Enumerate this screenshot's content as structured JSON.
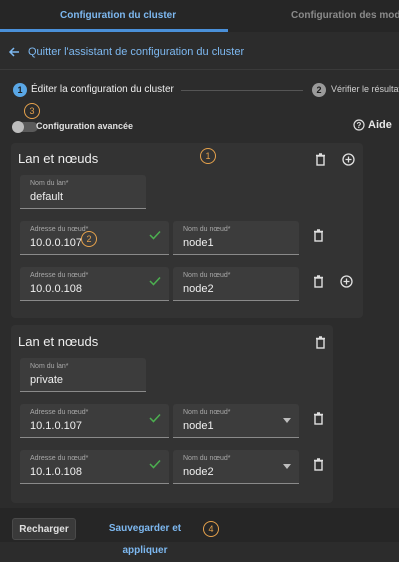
{
  "tabs": [
    "Configuration du cluster",
    "Configuration des modules"
  ],
  "back_label": "Quitter l'assistant de configuration du cluster",
  "steps": [
    {
      "number": "1",
      "label": "Éditer la configuration du cluster"
    },
    {
      "number": "2",
      "label": "Vérifier le résultat"
    }
  ],
  "advanced_config_label": "Configuration avancée",
  "advanced_config_enabled": false,
  "help_label": "Aide",
  "markers": [
    "1",
    "2",
    "3",
    "4"
  ],
  "lans": [
    {
      "title": "Lan et nœuds",
      "lan_name_label": "Nom du lan*",
      "lan_name": "default",
      "nodes": [
        {
          "address_label": "Adresse du nœud*",
          "address": "10.0.0.107",
          "name_label": "Nom du nœud*",
          "name": "node1"
        },
        {
          "address_label": "Adresse du nœud*",
          "address": "10.0.0.108",
          "name_label": "Nom du nœud*",
          "name": "node2"
        }
      ]
    },
    {
      "title": "Lan et nœuds",
      "lan_name_label": "Nom du lan*",
      "lan_name": "private",
      "nodes": [
        {
          "address_label": "Adresse du nœud*",
          "address": "10.1.0.107",
          "name_label": "Nom du nœud*",
          "name": "node1"
        },
        {
          "address_label": "Adresse du nœud*",
          "address": "10.1.0.108",
          "name_label": "Nom du nœud*",
          "name": "node2"
        }
      ]
    }
  ],
  "footer": {
    "reload_label": "Recharger",
    "save_label": "Sauvegarder et appliquer"
  },
  "colors": {
    "accent": "#7db8f0",
    "marker": "#e6a24c",
    "valid": "#4caf50",
    "background": "#2c2c2c"
  }
}
